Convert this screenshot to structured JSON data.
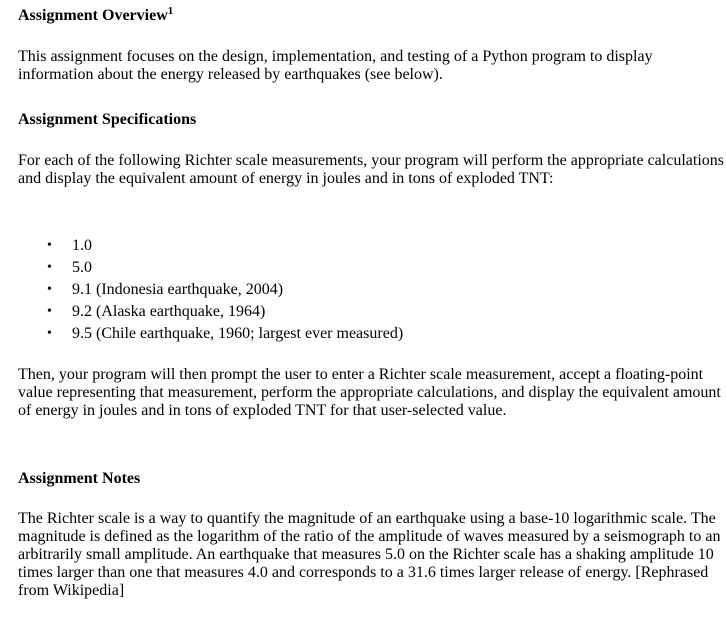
{
  "overview": {
    "heading": "Assignment Overview",
    "footnote_marker": "1",
    "paragraph": "This assignment focuses on the design, implementation, and testing of a Python program to display information about the energy released by earthquakes (see below)."
  },
  "specifications": {
    "heading": "Assignment Specifications",
    "paragraph": "For each of the following Richter scale measurements, your program will perform the appropriate calculations and display the equivalent amount of energy in joules and in tons of exploded TNT:",
    "bullet_glyph": "•",
    "measurements": [
      "1.0",
      "5.0",
      "9.1 (Indonesia earthquake, 2004)",
      "9.2 (Alaska earthquake, 1964)",
      "9.5 (Chile earthquake, 1960; largest ever measured)"
    ],
    "followup_paragraph": "Then, your program will then prompt the user to enter a Richter scale measurement, accept a floating-point value representing that measurement, perform the appropriate calculations, and display the equivalent amount of energy in joules and in tons of exploded TNT for that user-selected value."
  },
  "notes": {
    "heading": "Assignment Notes",
    "paragraph": "The Richter scale is a way to quantify the magnitude of an earthquake using a base-10 logarithmic scale. The magnitude is defined as the logarithm of the ratio of the amplitude of waves measured by a seismograph to an arbitrarily small amplitude. An earthquake that measures 5.0 on the Richter scale has a shaking amplitude 10 times larger than one that measures 4.0 and corresponds to a 31.6 times larger release of energy. [Rephrased from Wikipedia]"
  }
}
